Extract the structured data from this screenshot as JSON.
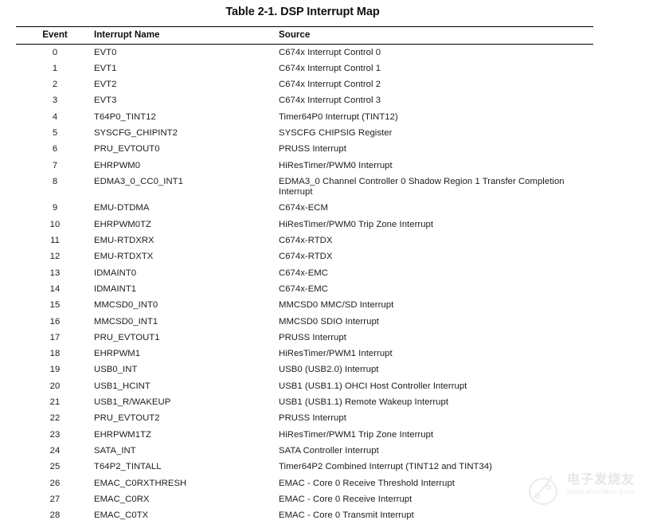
{
  "document": {
    "caption": "Table 2-1. DSP Interrupt Map",
    "page_background": "#ffffff",
    "rule_color": "#000000",
    "text_color": "#1c1c1c"
  },
  "table": {
    "columns": [
      {
        "key": "event",
        "label": "Event",
        "align": "center"
      },
      {
        "key": "name",
        "label": "Interrupt Name",
        "align": "left"
      },
      {
        "key": "source",
        "label": "Source",
        "align": "left"
      }
    ],
    "rows": [
      {
        "event": "0",
        "name": "EVT0",
        "source": "C674x Interrupt Control 0"
      },
      {
        "event": "1",
        "name": "EVT1",
        "source": "C674x Interrupt Control 1"
      },
      {
        "event": "2",
        "name": "EVT2",
        "source": "C674x Interrupt Control 2"
      },
      {
        "event": "3",
        "name": "EVT3",
        "source": "C674x Interrupt Control 3"
      },
      {
        "event": "4",
        "name": "T64P0_TINT12",
        "source": "Timer64P0 Interrupt (TINT12)"
      },
      {
        "event": "5",
        "name": "SYSCFG_CHIPINT2",
        "source": "SYSCFG CHIPSIG Register"
      },
      {
        "event": "6",
        "name": "PRU_EVTOUT0",
        "source": "PRUSS Interrupt"
      },
      {
        "event": "7",
        "name": "EHRPWM0",
        "source": "HiResTimer/PWM0 Interrupt"
      },
      {
        "event": "8",
        "name": "EDMA3_0_CC0_INT1",
        "source": "EDMA3_0 Channel Controller 0 Shadow Region 1 Transfer Completion Interrupt"
      },
      {
        "event": "9",
        "name": "EMU-DTDMA",
        "source": "C674x-ECM"
      },
      {
        "event": "10",
        "name": "EHRPWM0TZ",
        "source": "HiResTimer/PWM0 Trip Zone Interrupt"
      },
      {
        "event": "11",
        "name": "EMU-RTDXRX",
        "source": "C674x-RTDX"
      },
      {
        "event": "12",
        "name": "EMU-RTDXTX",
        "source": "C674x-RTDX"
      },
      {
        "event": "13",
        "name": "IDMAINT0",
        "source": "C674x-EMC"
      },
      {
        "event": "14",
        "name": "IDMAINT1",
        "source": "C674x-EMC"
      },
      {
        "event": "15",
        "name": "MMCSD0_INT0",
        "source": "MMCSD0 MMC/SD Interrupt"
      },
      {
        "event": "16",
        "name": "MMCSD0_INT1",
        "source": "MMCSD0 SDIO Interrupt"
      },
      {
        "event": "17",
        "name": "PRU_EVTOUT1",
        "source": "PRUSS Interrupt"
      },
      {
        "event": "18",
        "name": "EHRPWM1",
        "source": "HiResTimer/PWM1 Interrupt"
      },
      {
        "event": "19",
        "name": "USB0_INT",
        "source": "USB0 (USB2.0) Interrupt"
      },
      {
        "event": "20",
        "name": "USB1_HCINT",
        "source": "USB1 (USB1.1) OHCI Host Controller Interrupt"
      },
      {
        "event": "21",
        "name": "USB1_R/WAKEUP",
        "source": "USB1 (USB1.1) Remote Wakeup Interrupt"
      },
      {
        "event": "22",
        "name": "PRU_EVTOUT2",
        "source": "PRUSS Interrupt"
      },
      {
        "event": "23",
        "name": "EHRPWM1TZ",
        "source": "HiResTimer/PWM1 Trip Zone Interrupt"
      },
      {
        "event": "24",
        "name": "SATA_INT",
        "source": "SATA Controller Interrupt"
      },
      {
        "event": "25",
        "name": "T64P2_TINTALL",
        "source": "Timer64P2 Combined Interrupt (TINT12 and TINT34)"
      },
      {
        "event": "26",
        "name": "EMAC_C0RXTHRESH",
        "source": "EMAC - Core 0 Receive Threshold Interrupt"
      },
      {
        "event": "27",
        "name": "EMAC_C0RX",
        "source": "EMAC - Core 0 Receive Interrupt"
      },
      {
        "event": "28",
        "name": "EMAC_C0TX",
        "source": "EMAC - Core 0 Transmit Interrupt"
      }
    ]
  },
  "watermark": {
    "chinese_text": "电子发烧友",
    "url_text": "www.elecfans.com",
    "color": "#bcbcc2"
  }
}
